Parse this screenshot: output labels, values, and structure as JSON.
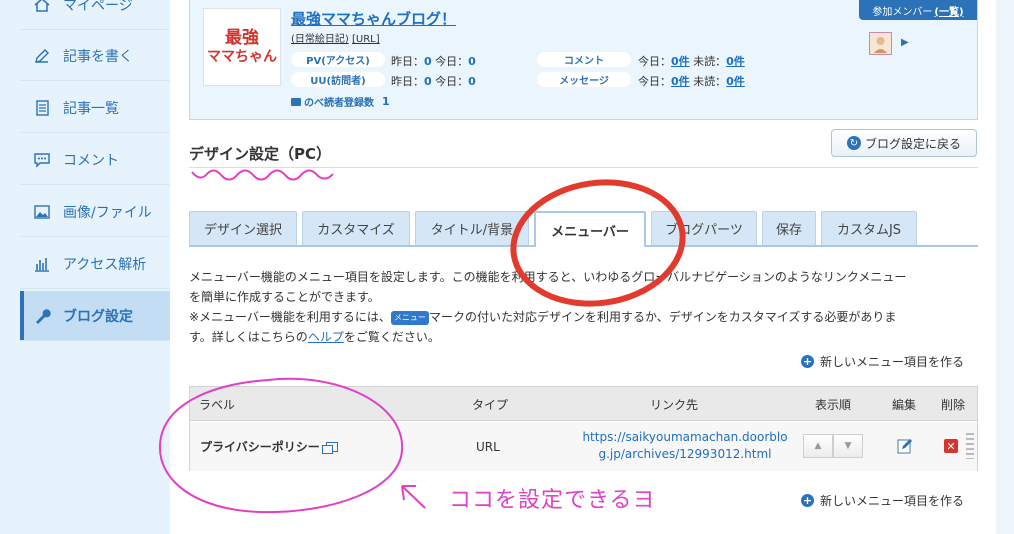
{
  "sidebar": {
    "items": [
      {
        "label": "マイページ",
        "icon": "home-icon"
      },
      {
        "label": "記事を書く",
        "icon": "pen-icon"
      },
      {
        "label": "記事一覧",
        "icon": "document-list-icon"
      },
      {
        "label": "コメント",
        "icon": "comment-icon"
      },
      {
        "label": "画像/ファイル",
        "icon": "image-icon"
      },
      {
        "label": "アクセス解析",
        "icon": "bar-chart-icon"
      },
      {
        "label": "ブログ設定",
        "icon": "wrench-icon",
        "active": true
      }
    ]
  },
  "blog": {
    "logo_line1": "最強",
    "logo_line2": "ママちゃん",
    "title": "最強ママちゃんブログ！",
    "category": "(日常絵日記)",
    "url_label": "[URL]",
    "stats": {
      "pv_label": "PV(アクセス)",
      "pv_text": "昨日：0 今日：0",
      "pv_yesterday": "0",
      "pv_today": "0",
      "uu_label": "UU(訪問者)",
      "uu_yesterday": "0",
      "uu_today": "0",
      "comment_label": "コメント",
      "comment_today": "0件",
      "comment_unread": "0件",
      "message_label": "メッセージ",
      "message_today": "0件",
      "message_unread": "0件",
      "yesterday_prefix": "昨日：",
      "today_prefix": "今日：",
      "unread_prefix": "未読：",
      "reader_label": "のべ読者登録数",
      "reader_count": "1"
    },
    "members_label": "参加メンバー",
    "members_link": "(一覧)"
  },
  "section": {
    "title": "デザイン設定（PC）",
    "back_button": "ブログ設定に戻る"
  },
  "tabs": [
    {
      "label": "デザイン選択"
    },
    {
      "label": "カスタマイズ"
    },
    {
      "label": "タイトル/背景"
    },
    {
      "label": "メニューバー",
      "active": true
    },
    {
      "label": "ブログパーツ"
    },
    {
      "label": "保存"
    },
    {
      "label": "カスタムJS"
    }
  ],
  "description": {
    "line1": "メニューバー機能のメニュー項目を設定します。この機能を利用すると、いわゆるグローバルナビゲーションのようなリンクメニュー",
    "line2": "を簡単に作成することができます。",
    "line3_pre": "※メニューバー機能を利用するには、",
    "badge": "メニュー",
    "line3_post": "マークの付いた対応デザインを利用するか、デザインをカスタマイズする必要がありま",
    "line4_pre": "す。詳しくはこちらの",
    "help_link": "ヘルプ",
    "line4_post": "をご覧ください。"
  },
  "new_item_link": "新しいメニュー項目を作る",
  "table": {
    "headers": {
      "label": "ラベル",
      "type": "タイプ",
      "link": "リンク先",
      "order": "表示順",
      "edit": "編集",
      "delete": "削除"
    },
    "rows": [
      {
        "label": "プライバシーポリシー",
        "type": "URL",
        "link_line1": "https://saikyoumamachan.doorblo",
        "link_line2": "g.jp/archives/12993012.html"
      }
    ]
  },
  "annotation": {
    "text": "ココを設定できるヨ",
    "color": "#e040c8",
    "circle_color": "#e23b2e"
  }
}
